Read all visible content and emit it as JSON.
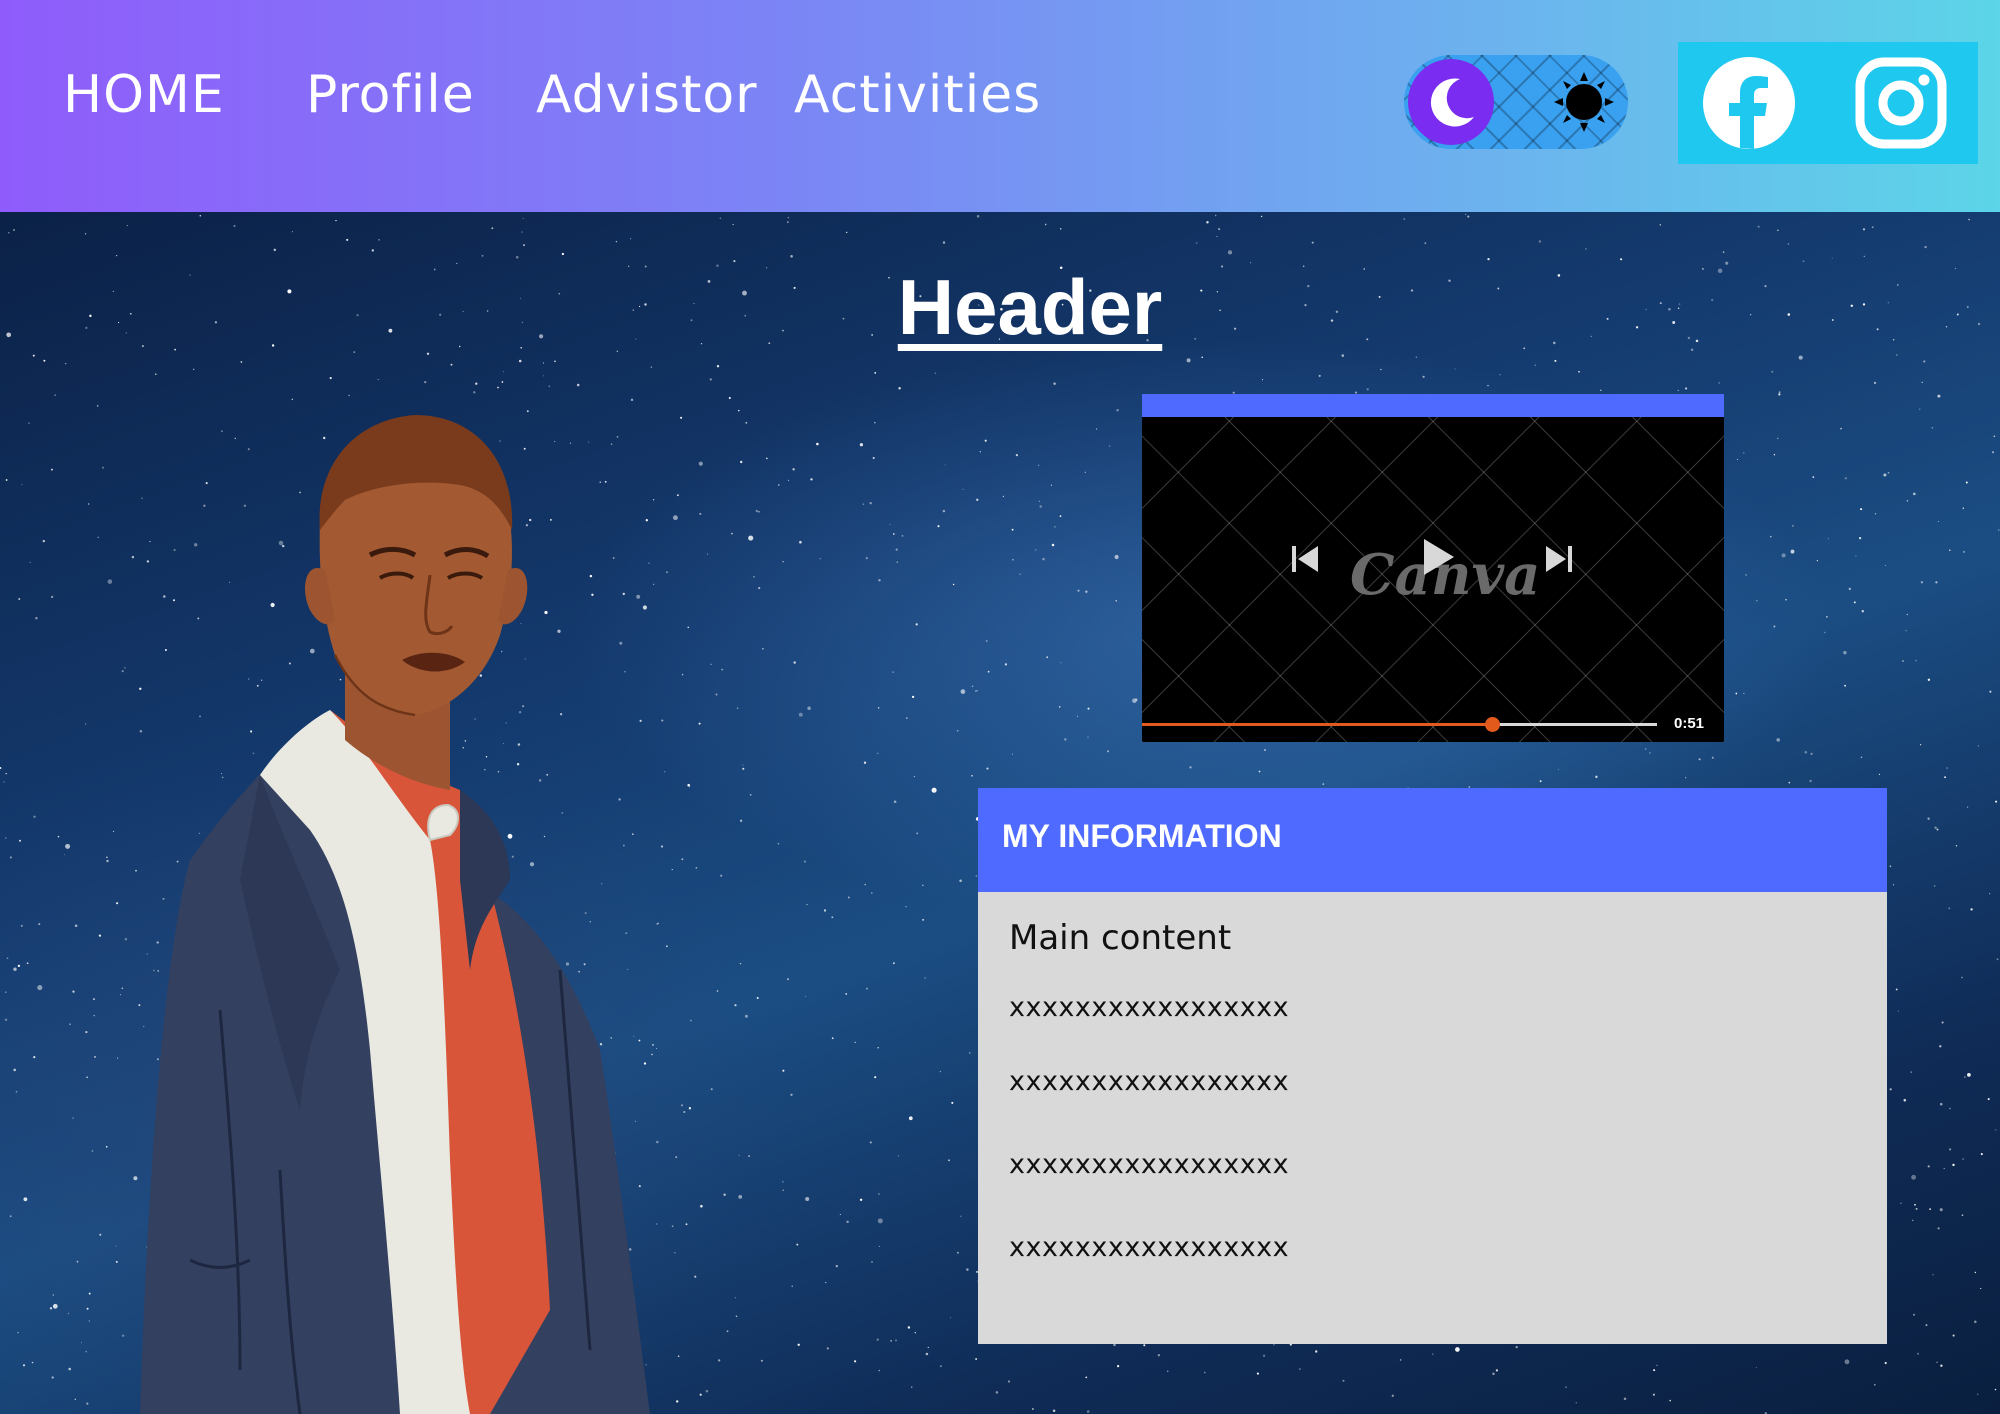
{
  "nav": {
    "items": [
      {
        "label": "HOME"
      },
      {
        "label": "Profile"
      },
      {
        "label": "Advistor"
      },
      {
        "label": "Activities"
      }
    ],
    "theme_toggle": {
      "state": "dark",
      "icons": [
        "moon-icon",
        "sun-icon"
      ]
    },
    "social": [
      {
        "icon": "facebook-icon"
      },
      {
        "icon": "instagram-icon"
      }
    ]
  },
  "page": {
    "title": "Header"
  },
  "video": {
    "watermark": "Canva",
    "time": "0:51",
    "progress": 0.68,
    "controls": [
      "previous-icon",
      "play-icon",
      "next-icon"
    ]
  },
  "info": {
    "title": "MY INFORMATION",
    "main": "Main content",
    "lines": [
      "xxxxxxxxxxxxxxxxx",
      "xxxxxxxxxxxxxxxxx",
      "xxxxxxxxxxxxxxxxx",
      "xxxxxxxxxxxxxxxxx"
    ]
  },
  "colors": {
    "nav_gradient_start": "#8f5cfb",
    "nav_gradient_end": "#5cd5e8",
    "accent": "#4f6bff",
    "panel_bg": "#d9d9d9",
    "progress": "#e25a1c"
  }
}
